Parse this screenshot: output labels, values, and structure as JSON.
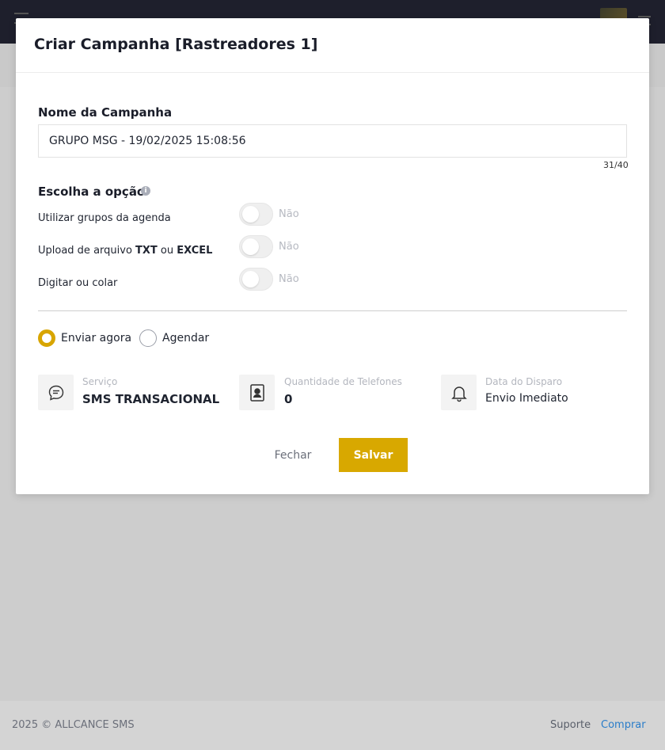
{
  "footer": {
    "copyright": "2025 © ALLCANCE SMS",
    "suporte": "Suporte",
    "comprar": "Comprar"
  },
  "modal": {
    "title": "Criar Campanha [Rastreadores 1]",
    "nome_label": "Nome da Campanha",
    "nome_value": "GRUPO MSG - 19/02/2025 15:08:56",
    "nome_counter": "31/40",
    "escolha_label": "Escolha a opção",
    "options": [
      {
        "label_pre": "Utilizar grupos da agenda",
        "label_b1": "",
        "label_mid": "",
        "label_b2": "",
        "toggle": "Não"
      },
      {
        "label_pre": "Upload de arquivo ",
        "label_b1": "TXT",
        "label_mid": " ou ",
        "label_b2": "EXCEL",
        "toggle": "Não"
      },
      {
        "label_pre": "Digitar ou colar",
        "label_b1": "",
        "label_mid": "",
        "label_b2": "",
        "toggle": "Não"
      }
    ],
    "radios": {
      "enviar_agora": "Enviar agora",
      "agendar": "Agendar"
    },
    "servico": {
      "label": "Serviço",
      "value": "SMS TRANSACIONAL"
    },
    "quantidade": {
      "label": "Quantidade de Telefones",
      "value": "0"
    },
    "data_disparo": {
      "label": "Data do Disparo",
      "value": "Envio Imediato"
    },
    "buttons": {
      "fechar": "Fechar",
      "salvar": "Salvar"
    }
  },
  "colors": {
    "accent": "#d8a800",
    "topbar": "#1e1f2c",
    "link": "#2a7dc9"
  }
}
